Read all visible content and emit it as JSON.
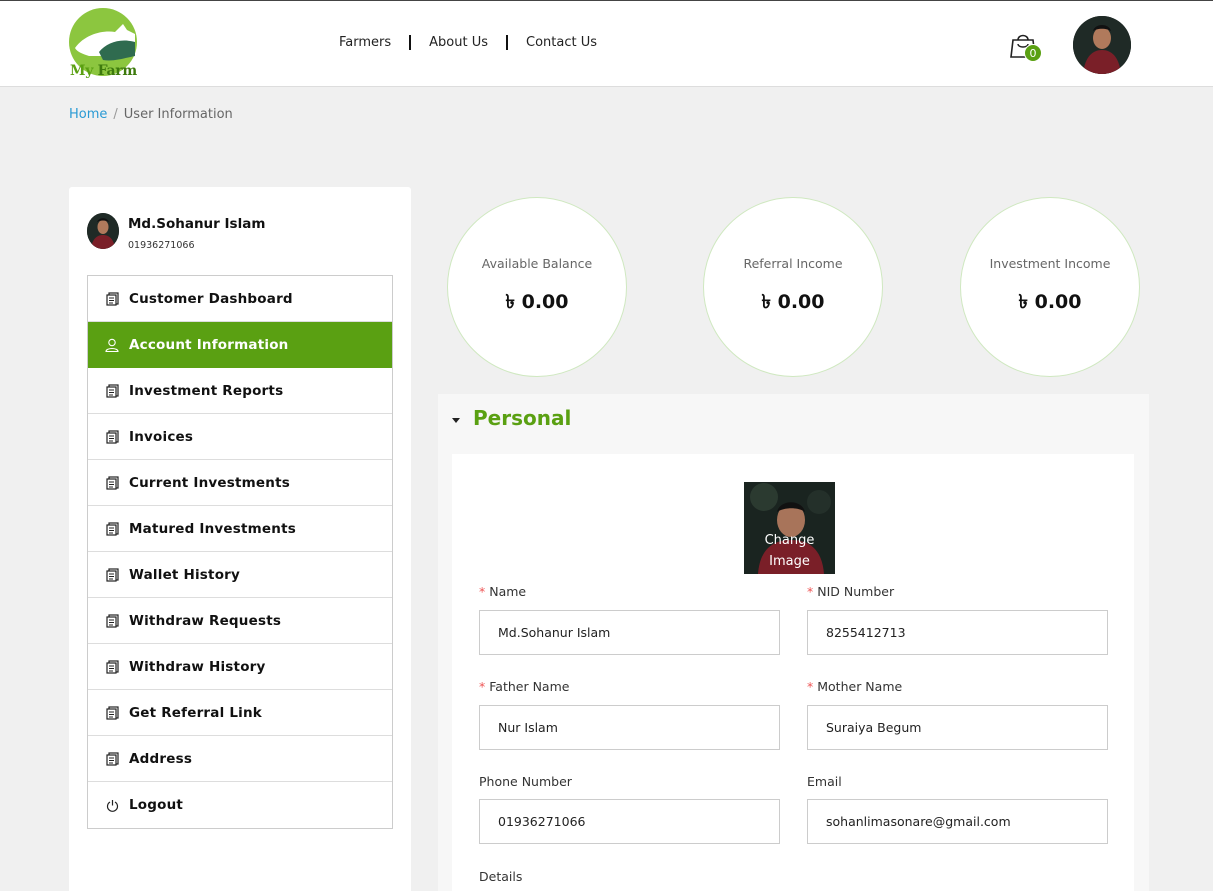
{
  "brand": {
    "name_prefix": "My",
    "name_suffix": " Farm"
  },
  "nav": {
    "items": [
      "Farmers",
      "About Us",
      "Contact Us"
    ]
  },
  "cart": {
    "count": "0",
    "icon": "shopping-bag-icon"
  },
  "breadcrumb": {
    "home": "Home",
    "separator": "/",
    "current": "User Information"
  },
  "profile": {
    "name": "Md.Sohanur Islam",
    "phone": "01936271066"
  },
  "menu": {
    "items": [
      {
        "label": "Customer Dashboard",
        "icon": "document-icon",
        "active": false
      },
      {
        "label": "Account Information",
        "icon": "user-icon",
        "active": true
      },
      {
        "label": "Investment Reports",
        "icon": "document-icon",
        "active": false
      },
      {
        "label": "Invoices",
        "icon": "document-icon",
        "active": false
      },
      {
        "label": "Current Investments",
        "icon": "document-icon",
        "active": false
      },
      {
        "label": "Matured Investments",
        "icon": "document-icon",
        "active": false
      },
      {
        "label": "Wallet History",
        "icon": "document-icon",
        "active": false
      },
      {
        "label": "Withdraw Requests",
        "icon": "document-icon",
        "active": false
      },
      {
        "label": "Withdraw History",
        "icon": "document-icon",
        "active": false
      },
      {
        "label": "Get Referral Link",
        "icon": "document-icon",
        "active": false
      },
      {
        "label": "Address",
        "icon": "document-icon",
        "active": false
      },
      {
        "label": "Logout",
        "icon": "power-icon",
        "active": false
      }
    ]
  },
  "stats": [
    {
      "label": "Available Balance",
      "value": "৳ 0.00"
    },
    {
      "label": "Referral Income",
      "value": "৳ 0.00"
    },
    {
      "label": "Investment Income",
      "value": "৳ 0.00"
    }
  ],
  "personal": {
    "title": "Personal",
    "change_image": "Change Image",
    "fields": {
      "name": {
        "label": "Name",
        "required": true,
        "value": "Md.Sohanur Islam"
      },
      "nid": {
        "label": "NID Number",
        "required": true,
        "value": "8255412713"
      },
      "father": {
        "label": "Father Name",
        "required": true,
        "value": "Nur Islam"
      },
      "mother": {
        "label": "Mother Name",
        "required": true,
        "value": "Suraiya Begum"
      },
      "phone": {
        "label": "Phone Number",
        "required": false,
        "value": "01936271066"
      },
      "email": {
        "label": "Email",
        "required": false,
        "value": "sohanlimasonare@gmail.com"
      },
      "details": {
        "label": "Details"
      }
    },
    "required_mark": "*"
  },
  "colors": {
    "accent": "#5aa012",
    "link": "#2a9ad4",
    "required": "#ee5555"
  }
}
